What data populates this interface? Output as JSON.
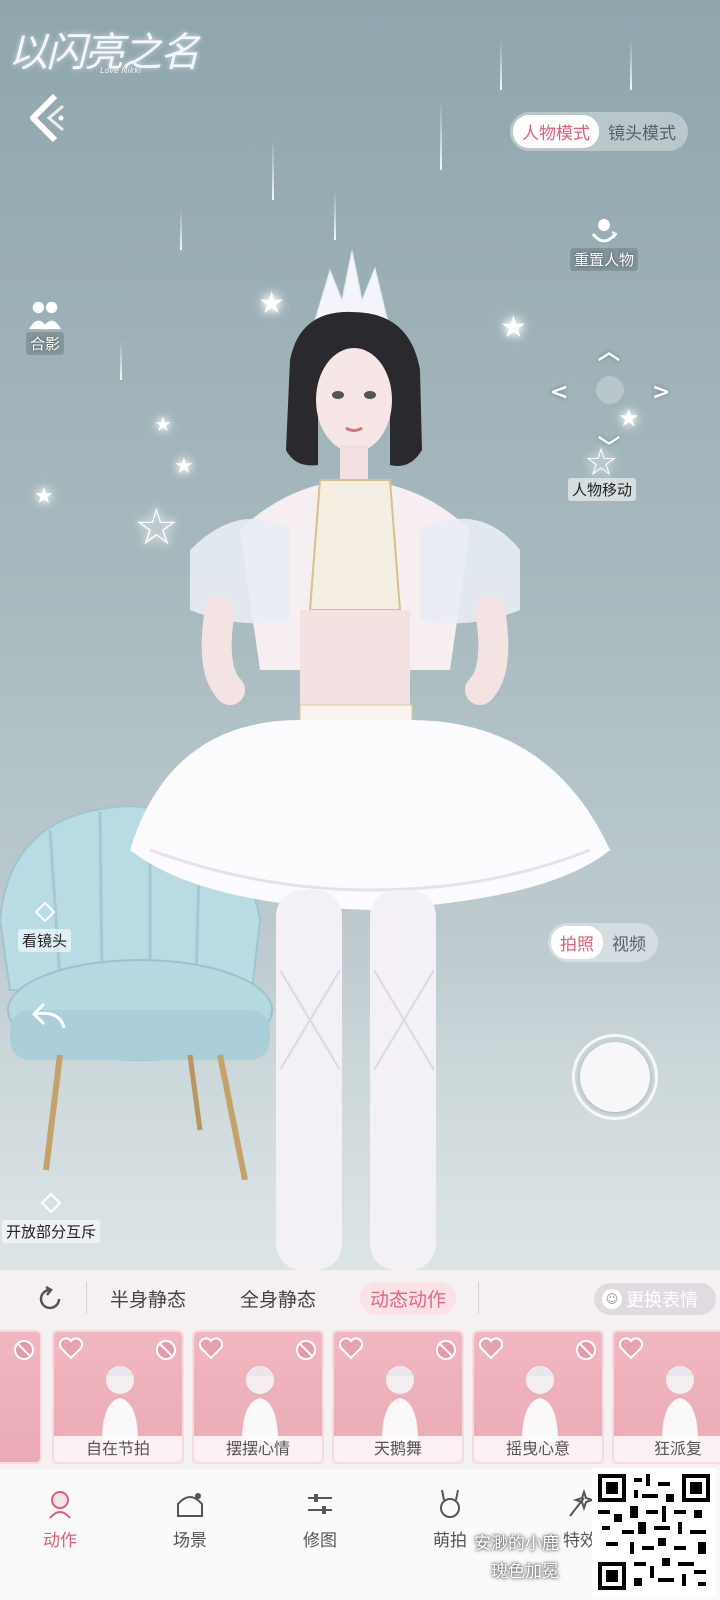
{
  "app": {
    "logo": "以闪亮之名",
    "logo_sub": "Love Nikki"
  },
  "top": {
    "mode_tabs": [
      {
        "label": "人物模式",
        "active": true
      },
      {
        "label": "镜头模式",
        "active": false
      }
    ]
  },
  "tools": {
    "reset_character": "重置人物",
    "group_photo": "合影",
    "move_character": "人物移动",
    "look_at_camera": "看镜头",
    "partial_mutex": "开放部分互斥"
  },
  "capture": {
    "tabs": [
      {
        "label": "拍照",
        "active": true
      },
      {
        "label": "视频",
        "active": false
      }
    ]
  },
  "pose_tabs": [
    {
      "label": "半身静态",
      "active": false
    },
    {
      "label": "全身静态",
      "active": false
    },
    {
      "label": "动态动作",
      "active": true
    }
  ],
  "change_expression": "更换表情",
  "pose_cards": [
    {
      "label": "自在节拍"
    },
    {
      "label": "摆摆心情"
    },
    {
      "label": "天鹅舞"
    },
    {
      "label": "摇曳心意"
    },
    {
      "label": "狂派复"
    }
  ],
  "nav": [
    {
      "label": "动作",
      "icon": "pose-icon",
      "active": true
    },
    {
      "label": "场景",
      "icon": "scene-icon",
      "active": false
    },
    {
      "label": "修图",
      "icon": "adjust-icon",
      "active": false
    },
    {
      "label": "萌拍",
      "icon": "bunny-icon",
      "active": false
    },
    {
      "label": "特效",
      "icon": "effect-icon",
      "active": false
    }
  ],
  "watermark": {
    "line1": "安渺的小鹿",
    "line2": "瑰色加冕"
  },
  "colors": {
    "accent": "#e0607a",
    "panel_bg": "#f5f1f3",
    "card_bg": "#efb3be"
  }
}
